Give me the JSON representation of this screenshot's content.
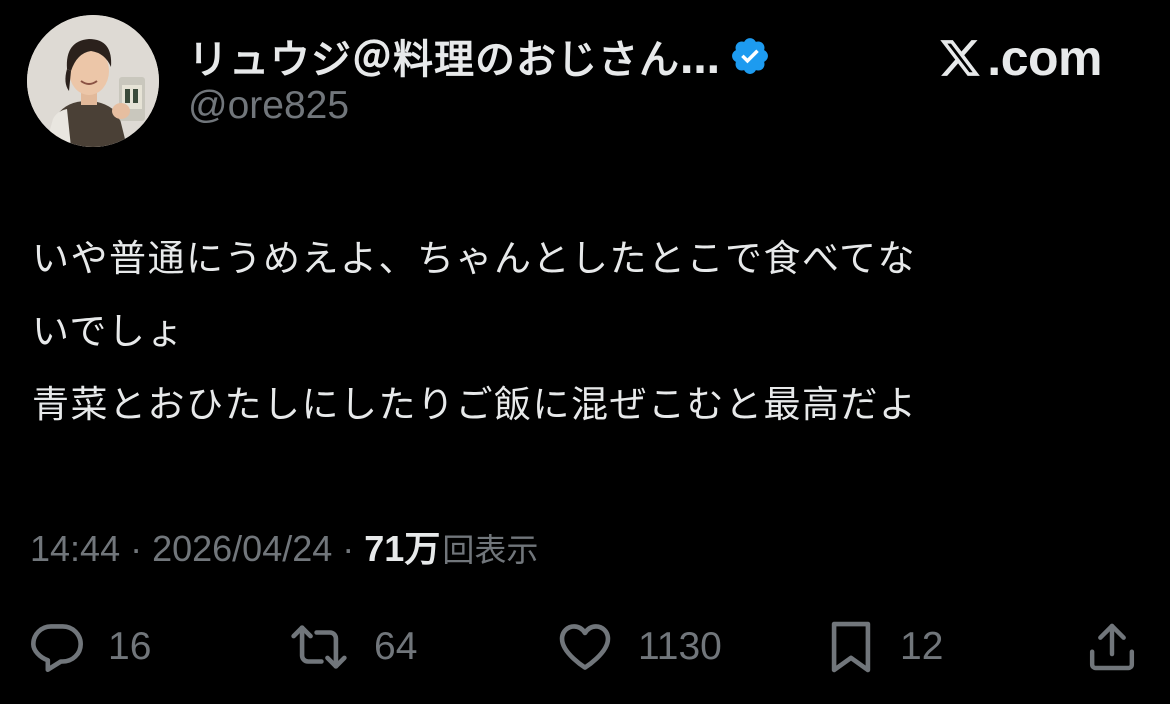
{
  "header": {
    "display_name": "リュウジ＠料理のおじさん…",
    "handle": "@ore825",
    "verified_icon": "verified-badge-icon",
    "brand_text": ".com",
    "colors": {
      "background": "#000000",
      "primary_text": "#e7e9ea",
      "secondary_text": "#71767b",
      "verified_blue": "#1d9bf0"
    }
  },
  "tweet": {
    "lines": [
      "いや普通にうめえよ、ちゃんとしたとこで食べてな",
      "いでしょ",
      "青菜とおひたしにしたりご飯に混ぜこむと最高だよ"
    ]
  },
  "meta": {
    "time": "14:44",
    "separator": "·",
    "date": "2026/04/24",
    "views_count": "71万",
    "views_label": "回表示"
  },
  "actions": {
    "reply": {
      "icon": "reply-icon",
      "count": "16"
    },
    "retweet": {
      "icon": "retweet-icon",
      "count": "64"
    },
    "like": {
      "icon": "heart-icon",
      "count": "1130"
    },
    "bookmark": {
      "icon": "bookmark-icon",
      "count": "12"
    },
    "share": {
      "icon": "share-icon"
    }
  }
}
